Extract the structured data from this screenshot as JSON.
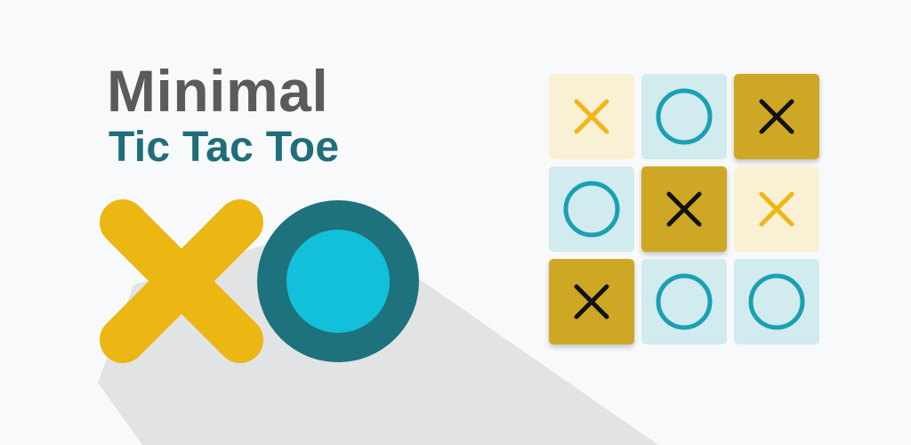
{
  "title": {
    "main": "Minimal",
    "sub": "Tic Tac Toe"
  },
  "logo": {
    "x_icon": "x-mark-icon",
    "o_icon": "o-mark-icon",
    "colors": {
      "x": "#ecb613",
      "o_ring": "#1e727d",
      "o_center": "#12c1d9",
      "shadow": "#e2e3e5"
    }
  },
  "board": {
    "cells": [
      {
        "mark": "X",
        "style": "light-x"
      },
      {
        "mark": "O",
        "style": "light-o"
      },
      {
        "mark": "X",
        "style": "dark-x"
      },
      {
        "mark": "O",
        "style": "light-o"
      },
      {
        "mark": "X",
        "style": "dark-x"
      },
      {
        "mark": "X",
        "style": "light-x"
      },
      {
        "mark": "X",
        "style": "dark-x"
      },
      {
        "mark": "O",
        "style": "light-o"
      },
      {
        "mark": "O",
        "style": "light-o"
      }
    ],
    "palette": {
      "light-x": {
        "bg": "#faf0d4",
        "fg": "#efb716"
      },
      "light-o": {
        "bg": "#d1ebef",
        "fg": "#1aa0b3"
      },
      "dark-x": {
        "bg": "#cea824",
        "fg": "#111111"
      }
    }
  }
}
